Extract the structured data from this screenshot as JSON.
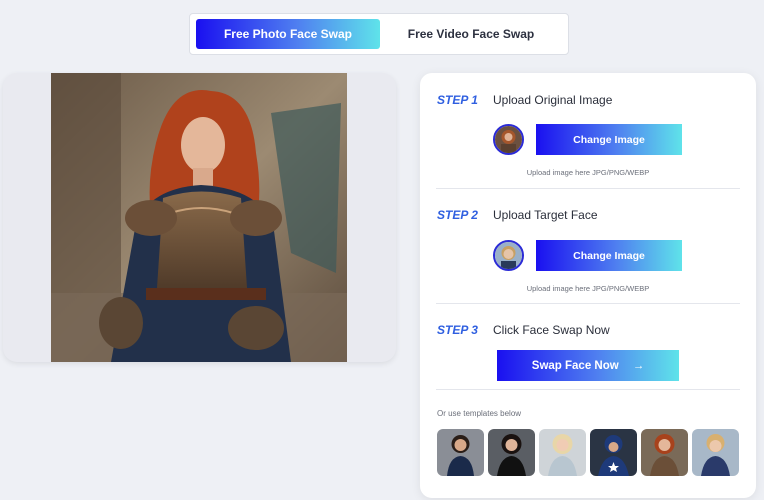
{
  "mode_tabs": {
    "photo": "Free Photo Face Swap",
    "video": "Free Video Face Swap"
  },
  "steps": [
    {
      "number": "STEP 1",
      "title": "Upload Original Image",
      "button": "Change Image",
      "hint": "Upload image here JPG/PNG/WEBP"
    },
    {
      "number": "STEP 2",
      "title": "Upload Target Face",
      "button": "Change Image",
      "hint": "Upload image here JPG/PNG/WEBP"
    },
    {
      "number": "STEP 3",
      "title": "Click Face Swap Now",
      "button": "Swap Face Now",
      "button_icon": "→"
    }
  ],
  "templates_label": "Or use templates below",
  "templates": [
    {
      "name": "template-woman-dark-dress",
      "icon": "portrait"
    },
    {
      "name": "template-woman-black-outfit",
      "icon": "portrait"
    },
    {
      "name": "template-woman-blonde",
      "icon": "portrait"
    },
    {
      "name": "template-captain-hero",
      "icon": "portrait"
    },
    {
      "name": "template-armored-woman",
      "icon": "portrait"
    },
    {
      "name": "template-blond-man",
      "icon": "portrait"
    }
  ],
  "colors": {
    "accent_start": "#1a10f0",
    "accent_end": "#5fe3ea",
    "step_label": "#2f5fe0",
    "background": "#eef0f5"
  }
}
